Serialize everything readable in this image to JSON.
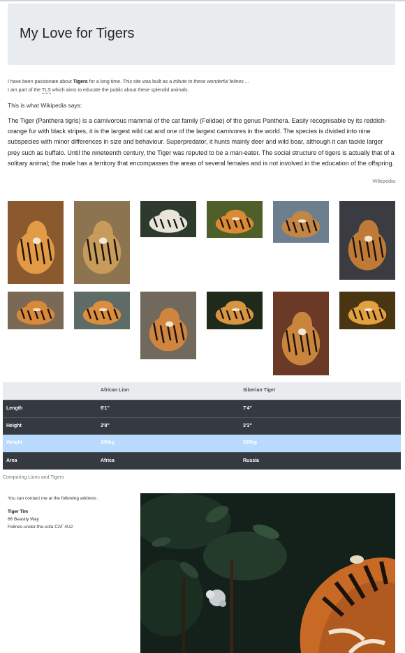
{
  "header": {
    "title": "My Love for Tigers"
  },
  "intro": {
    "line1_before": "I have been passionate about ",
    "line1_bold": "Tigers",
    "line1_middle": " for a long time. This site was built as a ",
    "line1_italic": "tribute to these wonderful felines ...",
    "line2_before": "I am part of the ",
    "line2_abbr": "TLS",
    "line2_after": " which aims to educate the public about these splendid animals."
  },
  "wikipedia": {
    "says": "This is what Wikipedia says:",
    "quote": "The Tiger (Panthera tigris) is a carnivorous mammal of the cat family (Felidae) of the genus Panthera. Easily recognisable by its reddish-orange fur with black stripes, it is the largest wild cat and one of the largest carnivores in the world. The species is divided into nine subspecies with minor differences in size and behaviour. Superpredator, it hunts mainly deer and wild boar, although it can tackle larger prey such as buffalo. Until the nineteenth century, the Tiger was reputed to be a man-eater. The social structure of tigers is actually that of a solitary animal; the male has a territory that encompasses the areas of several females and is not involved in the education of the offspring.",
    "source": "Wikipedia"
  },
  "gallery": {
    "photos": [
      {
        "bg": "#8a5a2e",
        "accent": "#e39a44"
      },
      {
        "bg": "#8c7450",
        "accent": "#c79b59"
      },
      {
        "bg": "#2e3b2c",
        "accent": "#e7e4dc"
      },
      {
        "bg": "#4f5f2a",
        "accent": "#d98a33"
      },
      {
        "bg": "#6d7f8e",
        "accent": "#c48644"
      },
      {
        "bg": "#3b3c42",
        "accent": "#c07a38"
      },
      {
        "bg": "#7a6a55",
        "accent": "#d8893a"
      },
      {
        "bg": "#5e6b66",
        "accent": "#dd8e3c"
      },
      {
        "bg": "#70695c",
        "accent": "#cf8440"
      },
      {
        "bg": "#1f2a1a",
        "accent": "#d8953f"
      },
      {
        "bg": "#6a3a26",
        "accent": "#c9853d"
      },
      {
        "bg": "#4a3512",
        "accent": "#e2a03f"
      }
    ]
  },
  "comparison": {
    "headers": [
      "",
      "African Lion",
      "Siberian Tiger"
    ],
    "rows": [
      [
        "Length",
        "6'1\"",
        "7'4\""
      ],
      [
        "Height",
        "3'8\"",
        "3'3\""
      ],
      [
        "Weight",
        "180kg",
        "305kg"
      ],
      [
        "Area",
        "Africa",
        "Russia"
      ]
    ],
    "caption": "Comparing Lions and Tigers"
  },
  "contact": {
    "intro": "You can contact me at the following address :",
    "name": "Tiger Tim",
    "address1": "66 Beastly Way",
    "address2": "Felines-under-the-sofa CAT 4U2"
  }
}
